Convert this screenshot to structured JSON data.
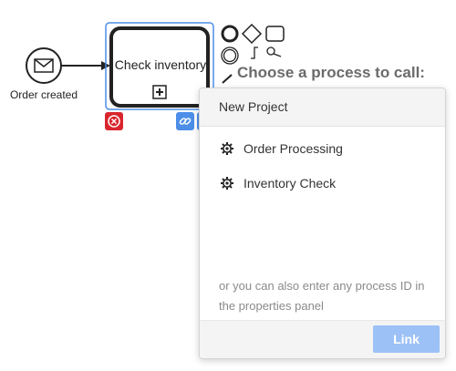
{
  "diagram": {
    "start_event_label": "Order created",
    "task_label": "Check inventory",
    "icons": {
      "start_event": "envelope-icon",
      "subprocess_marker": "plus-box-icon",
      "delete": "close-circle-icon",
      "link": "link-icon"
    }
  },
  "palette": {
    "icons": [
      "end-event-icon",
      "gateway-icon",
      "task-icon",
      "intermediate-event-icon",
      "text-annotation-icon",
      "change-type-icon",
      "connect-icon"
    ]
  },
  "popup": {
    "title": "Choose a process to call:",
    "project_name": "New Project",
    "processes": [
      {
        "label": "Order Processing",
        "icon": "gear-icon"
      },
      {
        "label": "Inventory Check",
        "icon": "gear-icon"
      }
    ],
    "hint": "or you can also enter any process ID in the properties panel",
    "link_button": "Link"
  },
  "colors": {
    "selection": "#4c8ee8",
    "delete": "#d9262e",
    "link_button": "#9cc1f6"
  }
}
